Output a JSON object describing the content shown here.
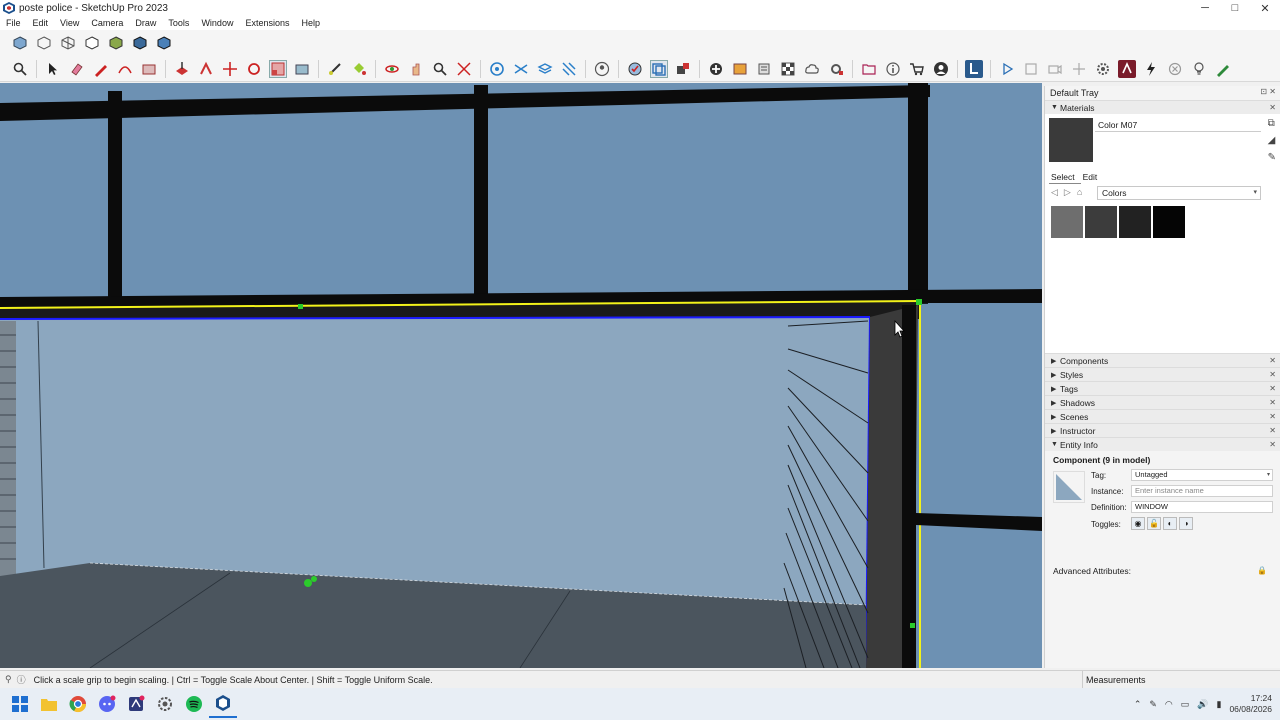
{
  "window": {
    "title": "poste police - SketchUp Pro 2023",
    "controls": [
      "─",
      "□",
      "✕"
    ]
  },
  "menu": [
    "File",
    "Edit",
    "View",
    "Camera",
    "Draw",
    "Tools",
    "Window",
    "Extensions",
    "Help"
  ],
  "toolbar_top_icons": [
    "select-tool",
    "eraser",
    "paint",
    "line",
    "rectangle"
  ],
  "tray": {
    "title": "Default Tray",
    "materials": {
      "header": "Materials",
      "current_name": "Color M07",
      "tab_select": "Select",
      "tab_edit": "Edit",
      "library": "Colors",
      "swatch_colors": [
        "#6e6e6e",
        "#3c3c3c",
        "#222222",
        "#050505"
      ],
      "current_color": "#3a3a3a"
    },
    "panels": [
      "Components",
      "Styles",
      "Tags",
      "Shadows",
      "Scenes",
      "Instructor",
      "Entity Info"
    ],
    "entity_info": {
      "title": "Component (9 in model)",
      "tag_label": "Tag:",
      "tag_value": "Untagged",
      "instance_label": "Instance:",
      "instance_placeholder": "Enter instance name",
      "definition_label": "Definition:",
      "definition_value": "WINDOW",
      "toggles_label": "Toggles:",
      "advanced": "Advanced Attributes:"
    }
  },
  "status": {
    "message": "Click a scale grip to begin scaling. | Ctrl = Toggle Scale About Center. | Shift = Toggle Uniform Scale.",
    "measurements_label": "Measurements"
  },
  "taskbar": {
    "time": "17:24",
    "date": "06/08/2026"
  },
  "colors": {
    "sky": "#6f93b5",
    "wall": "#8ea9c1",
    "frame": "#0b0b0b",
    "selection_yellow": "#f2f21a",
    "selection_blue": "#1a1aff",
    "accent_blue": "#2a5a8c"
  }
}
